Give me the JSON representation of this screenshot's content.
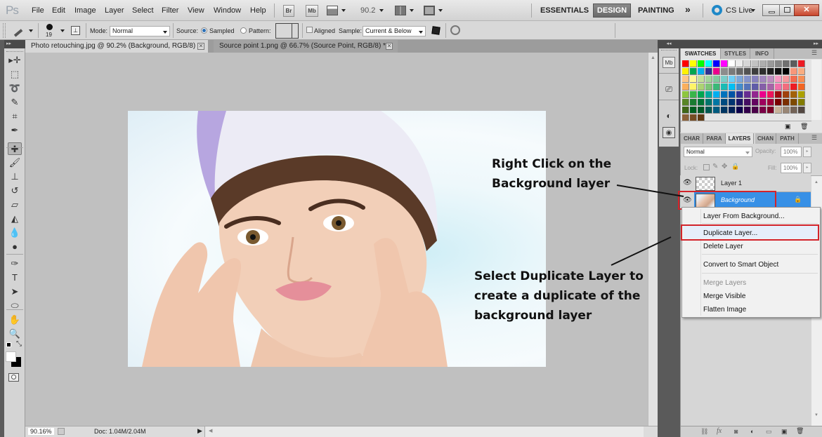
{
  "app": {
    "logo": "Ps",
    "menu": [
      "File",
      "Edit",
      "Image",
      "Layer",
      "Select",
      "Filter",
      "View",
      "Window",
      "Help"
    ],
    "appbar": {
      "bridge_label": "Br",
      "minibridge_label": "Mb",
      "zoom_value": "90.2"
    },
    "workspaces": [
      "ESSENTIALS",
      "DESIGN",
      "PAINTING"
    ],
    "active_workspace": "DESIGN",
    "more_workspaces": "»",
    "cs_live": "CS Live"
  },
  "options_bar": {
    "brush_size": "19",
    "mode_label": "Mode:",
    "mode_value": "Normal",
    "source_label": "Source:",
    "source_options": [
      "Sampled",
      "Pattern:"
    ],
    "source_selected": "Sampled",
    "aligned_label": "Aligned",
    "aligned_checked": false,
    "sample_label": "Sample:",
    "sample_value": "Current & Below"
  },
  "documents": [
    {
      "title": "Photo retouching.jpg @ 90.2% (Background, RGB/8) *",
      "active": true
    },
    {
      "title": "Source point 1.png @ 66.7% (Source Point, RGB/8) *",
      "active": false
    }
  ],
  "tools": [
    {
      "name": "move-tool",
      "glyph": "▸✛"
    },
    {
      "name": "marquee-tool",
      "glyph": "⬚"
    },
    {
      "name": "lasso-tool",
      "glyph": "➰"
    },
    {
      "name": "quick-selection-tool",
      "glyph": "✎"
    },
    {
      "name": "crop-tool",
      "glyph": "⌗"
    },
    {
      "name": "eyedropper-tool",
      "glyph": "✒"
    },
    {
      "name": "healing-brush-tool",
      "glyph": "✚",
      "selected": true
    },
    {
      "name": "brush-tool",
      "glyph": "🖌"
    },
    {
      "name": "clone-stamp-tool",
      "glyph": "⊥"
    },
    {
      "name": "history-brush-tool",
      "glyph": "↺"
    },
    {
      "name": "eraser-tool",
      "glyph": "▱"
    },
    {
      "name": "paint-bucket-tool",
      "glyph": "◭"
    },
    {
      "name": "blur-tool",
      "glyph": "💧"
    },
    {
      "name": "dodge-tool",
      "glyph": "●"
    },
    {
      "name": "pen-tool",
      "glyph": "✑"
    },
    {
      "name": "type-tool",
      "glyph": "T"
    },
    {
      "name": "path-selection-tool",
      "glyph": "➤"
    },
    {
      "name": "ellipse-tool",
      "glyph": "⬭"
    },
    {
      "name": "hand-tool",
      "glyph": "✋"
    },
    {
      "name": "zoom-tool",
      "glyph": "🔍"
    }
  ],
  "status": {
    "zoom": "90.16%",
    "doc_info": "Doc: 1.04M/2.04M"
  },
  "callouts": {
    "right_click": [
      "Right Click on the",
      "Background layer"
    ],
    "select_duplicate": [
      "Select Duplicate Layer to",
      "create a duplicate of the",
      "background layer"
    ]
  },
  "swatches_panel": {
    "tabs": [
      "SWATCHES",
      "STYLES",
      "INFO"
    ],
    "active_tab": "SWATCHES",
    "colors": [
      [
        "#ff0000",
        "#ffff00",
        "#00ff00",
        "#00ffff",
        "#0000ff",
        "#ff00ff",
        "#ffffff",
        "#ebebeb",
        "#d6d6d6",
        "#c2c2c2",
        "#adadad",
        "#999999",
        "#858585",
        "#707070",
        "#5c5c5c",
        "#ed1c24"
      ],
      [
        "#fff200",
        "#00a651",
        "#00aeef",
        "#2e3192",
        "#ec008c",
        "#8c8c8c",
        "#7a7a7a",
        "#666666",
        "#525252",
        "#3d3d3d",
        "#2e2e2e",
        "#1f1f1f",
        "#101010",
        "#000000",
        "#f7977a",
        "#f9ad81"
      ],
      [
        "#fdc68a",
        "#fff79a",
        "#c4df9b",
        "#a3d39c",
        "#82ca9d",
        "#7bcdc8",
        "#6ecff6",
        "#7ea7d8",
        "#8493ca",
        "#8882be",
        "#a187be",
        "#bc8dbf",
        "#f49ac2",
        "#f6989d",
        "#f26c4f",
        "#f68e55"
      ],
      [
        "#fbaf5d",
        "#fff467",
        "#acd373",
        "#7cc576",
        "#3bb878",
        "#1abbb4",
        "#00bff3",
        "#438ccb",
        "#5574b9",
        "#605ca8",
        "#855fa8",
        "#a763a8",
        "#f06eaa",
        "#f26d7d",
        "#ed1c24",
        "#f26522"
      ],
      [
        "#8dc63f",
        "#39b54a",
        "#00a651",
        "#00a99d",
        "#00aeef",
        "#0072bc",
        "#0054a6",
        "#2e3192",
        "#662d91",
        "#92278f",
        "#ec008c",
        "#ed145b",
        "#9e0b0f",
        "#a0410d",
        "#a36209",
        "#aba000"
      ],
      [
        "#598527",
        "#197b30",
        "#007236",
        "#00746b",
        "#0076a3",
        "#004a80",
        "#003471",
        "#1b1464",
        "#440e62",
        "#630460",
        "#9e005d",
        "#9e0039",
        "#790000",
        "#7b2e00",
        "#7d4900",
        "#827b00"
      ],
      [
        "#406618",
        "#005e20",
        "#005826",
        "#005952",
        "#005b7f",
        "#003663",
        "#002157",
        "#0d004c",
        "#32004b",
        "#4b0049",
        "#7b0046",
        "#7a0026",
        "#c7b299",
        "#998675",
        "#736357",
        "#534741"
      ],
      [
        "#8c6239",
        "#754c24",
        "#603913"
      ]
    ]
  },
  "layers_panel": {
    "tabs": [
      "CHAR",
      "PARA",
      "LAYERS",
      "CHAN",
      "PATH"
    ],
    "active_tab": "LAYERS",
    "blend_mode": "Normal",
    "opacity_label": "Opacity:",
    "opacity_value": "100%",
    "lock_label": "Lock:",
    "fill_label": "Fill:",
    "fill_value": "100%",
    "layers": [
      {
        "name": "Layer 1",
        "visible": true,
        "selected": false,
        "locked": false
      },
      {
        "name": "Background",
        "visible": true,
        "selected": true,
        "locked": true
      }
    ]
  },
  "context_menu": {
    "items": [
      {
        "label": "Layer From Background...",
        "enabled": true
      },
      {
        "label": "Duplicate Layer...",
        "enabled": true,
        "highlighted": true
      },
      {
        "label": "Delete Layer",
        "enabled": true
      },
      {
        "label": "Convert to Smart Object",
        "enabled": true
      },
      {
        "label": "Merge Layers",
        "enabled": false
      },
      {
        "label": "Merge Visible",
        "enabled": true
      },
      {
        "label": "Flatten Image",
        "enabled": true
      }
    ]
  },
  "colors": {
    "highlight_red": "#d2232a",
    "selection_blue": "#3790e6",
    "cs_live_blue": "#1e88c8"
  }
}
